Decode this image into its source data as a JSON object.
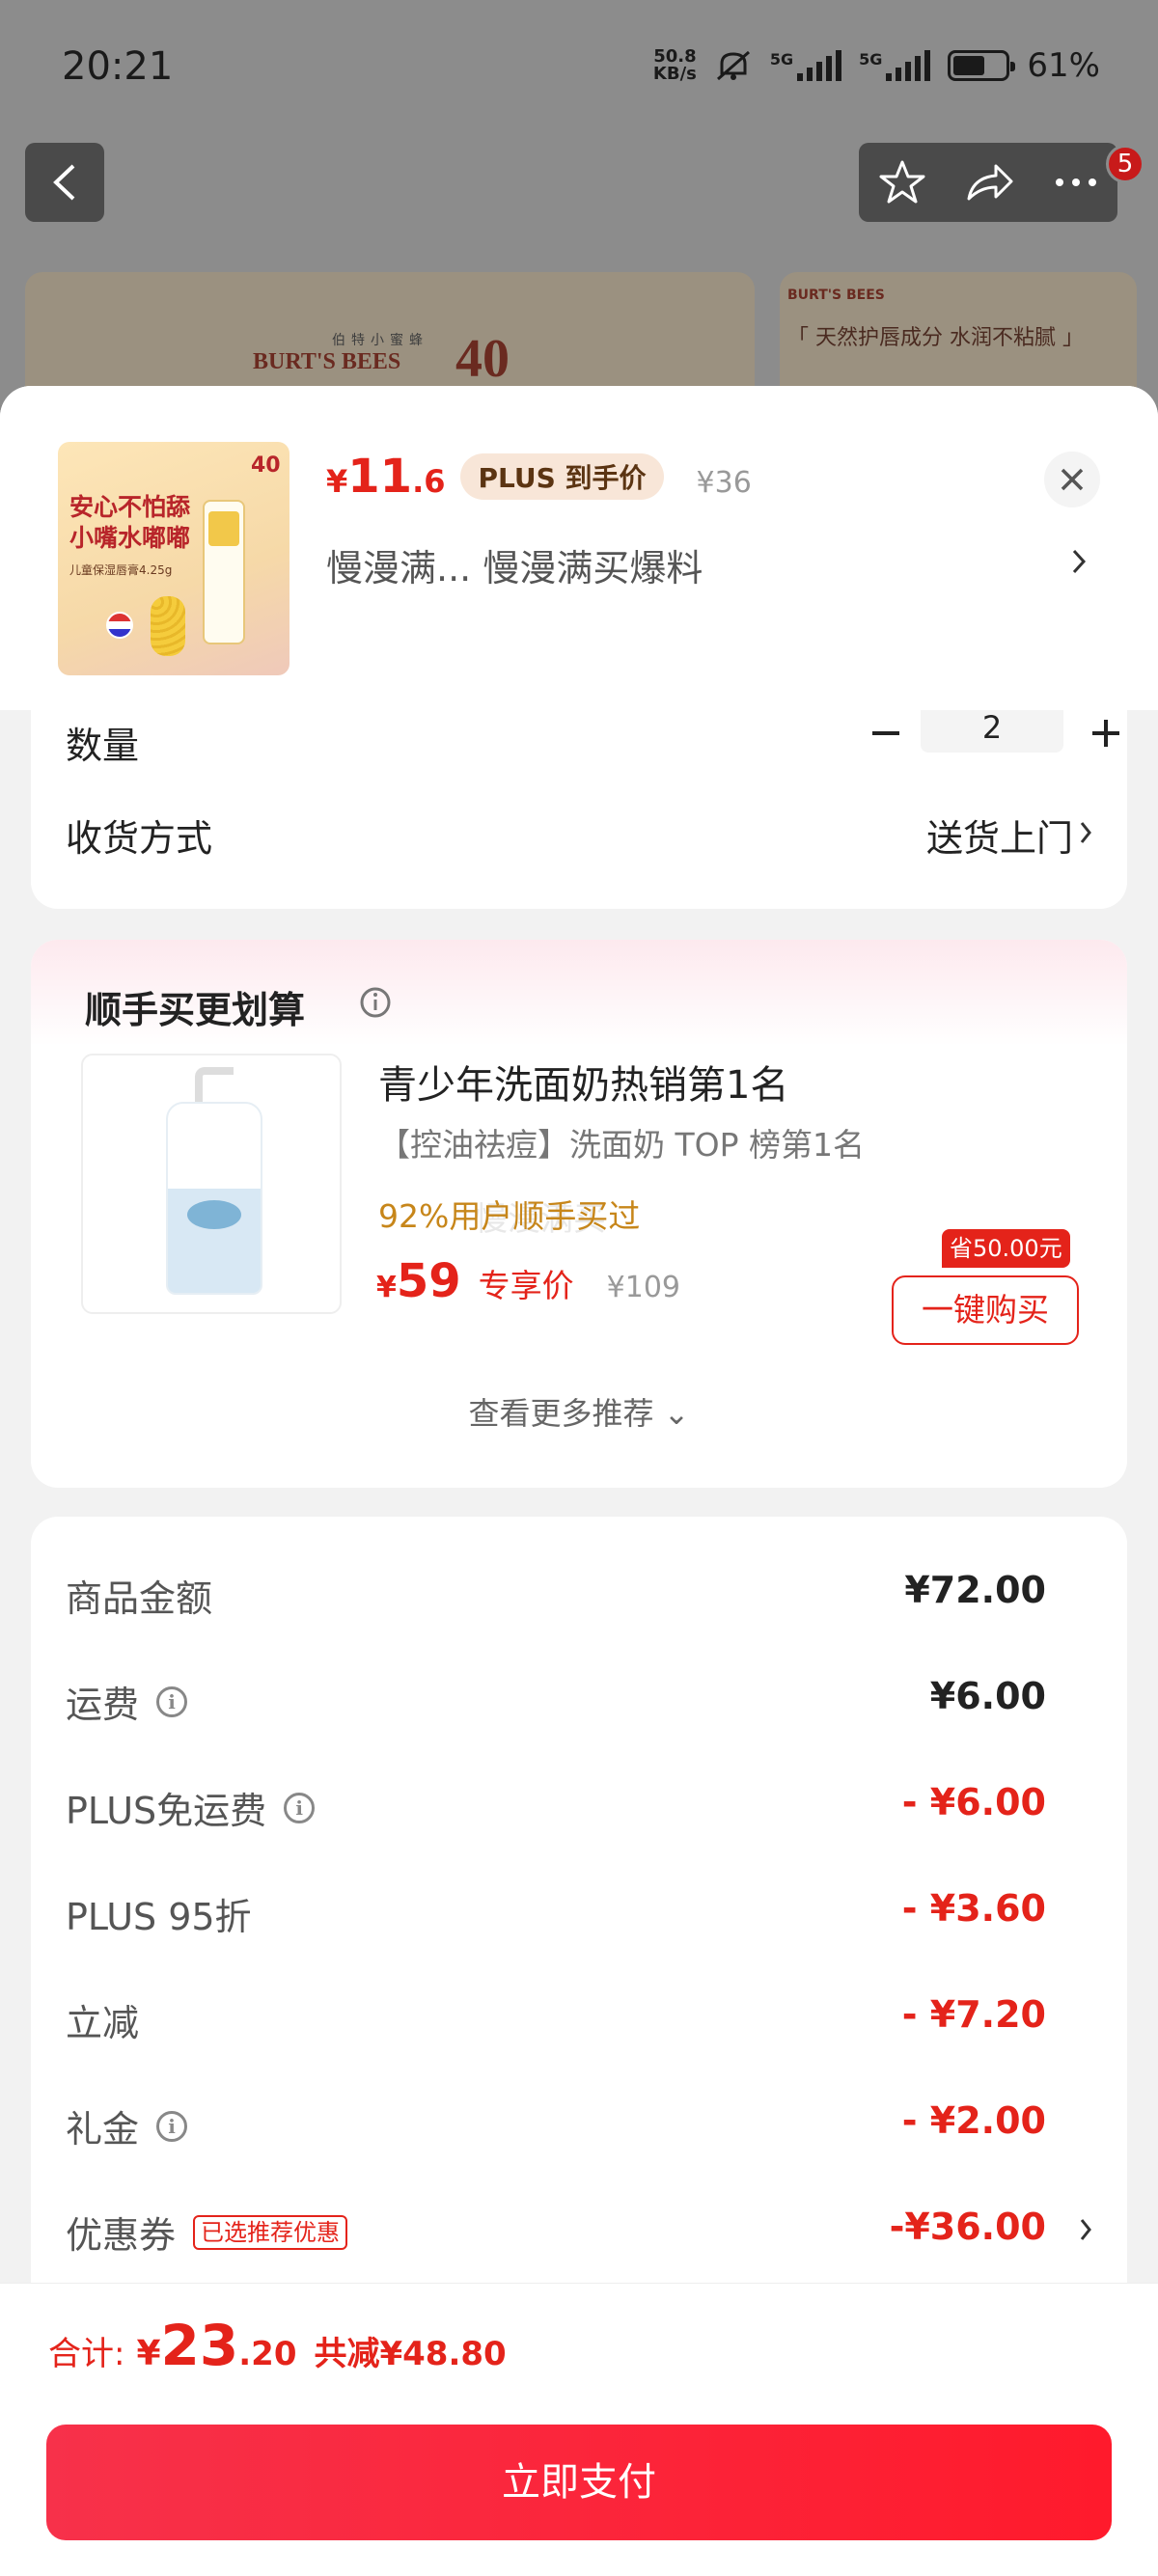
{
  "status_bar": {
    "time": "20:21",
    "net_speed_value": "50.8",
    "net_speed_unit": "KB/s",
    "signal1_label": "5G",
    "signal2_label": "5G",
    "battery_percent": 61,
    "battery_label": "61%"
  },
  "nav": {
    "badge_count": "5"
  },
  "banner": {
    "brand_cn": "伯特小蜜蜂",
    "brand_en": "BURT'S BEES",
    "anniversary": "40",
    "right_brand_en": "BURT'S BEES",
    "right_tagline": "「 天然护唇成分 水润不粘腻 」"
  },
  "product": {
    "thumbnail_tagline": "安心不怕舔\n小嘴水嘟嘟",
    "thumbnail_sub": "儿童保湿唇膏4.25g",
    "thumbnail_badge": "40",
    "price_yen": "¥",
    "price_int": "11",
    "price_dec": ".6",
    "plus_label": "PLUS 到手价",
    "original_price": "¥36",
    "variant_text": "慢漫满...  慢漫满买爆料"
  },
  "options": {
    "quantity_label": "数量",
    "quantity_value": "2",
    "delivery_label": "收货方式",
    "delivery_value": "送货上门"
  },
  "recommend": {
    "title": "顺手买更划算",
    "item": {
      "name": "青少年洗面奶热销第1名",
      "desc": "【控油祛痘】洗面奶 TOP 榜第1名",
      "buyers": "92%用户顺手买过",
      "watermark": "慢漫满买",
      "price_yen": "¥",
      "price_int": "59",
      "price_label": "专享价",
      "original_price": "¥109",
      "save_chip": "省50.00元",
      "buy_label": "一键购买"
    },
    "see_more": "查看更多推荐 ⌄"
  },
  "fees": [
    {
      "label": "商品金额",
      "value": "¥72.00",
      "info": false,
      "red": false
    },
    {
      "label": "运费",
      "value": "¥6.00",
      "info": true,
      "red": false
    },
    {
      "label": "PLUS免运费",
      "value": "- ¥6.00",
      "info": true,
      "red": true
    },
    {
      "label": "PLUS 95折",
      "value": "- ¥3.60",
      "info": false,
      "red": true
    },
    {
      "label": "立减",
      "value": "- ¥7.20",
      "info": false,
      "red": true
    },
    {
      "label": "礼金",
      "value": "- ¥2.00",
      "info": true,
      "red": true
    },
    {
      "label": "优惠券",
      "value": "-¥36.00",
      "info": false,
      "red": true,
      "chip": "已选推荐优惠"
    }
  ],
  "footer": {
    "total_label": "合计:",
    "total_yen": "¥",
    "total_int": "23",
    "total_dec": ".20",
    "total_reduced": "共减¥48.80",
    "pay_label": "立即支付"
  },
  "colors": {
    "accent_red": "#e4231a",
    "pay_button": "#ff1a2c",
    "plus_chip_bg": "#f8e6d8",
    "buyers_text": "#c7861a"
  },
  "icons": [
    "back-icon",
    "star-icon",
    "share-icon",
    "more-icon",
    "close-icon",
    "chevron-right-icon",
    "minus-icon",
    "plus-icon",
    "info-icon",
    "chevron-down-icon"
  ]
}
